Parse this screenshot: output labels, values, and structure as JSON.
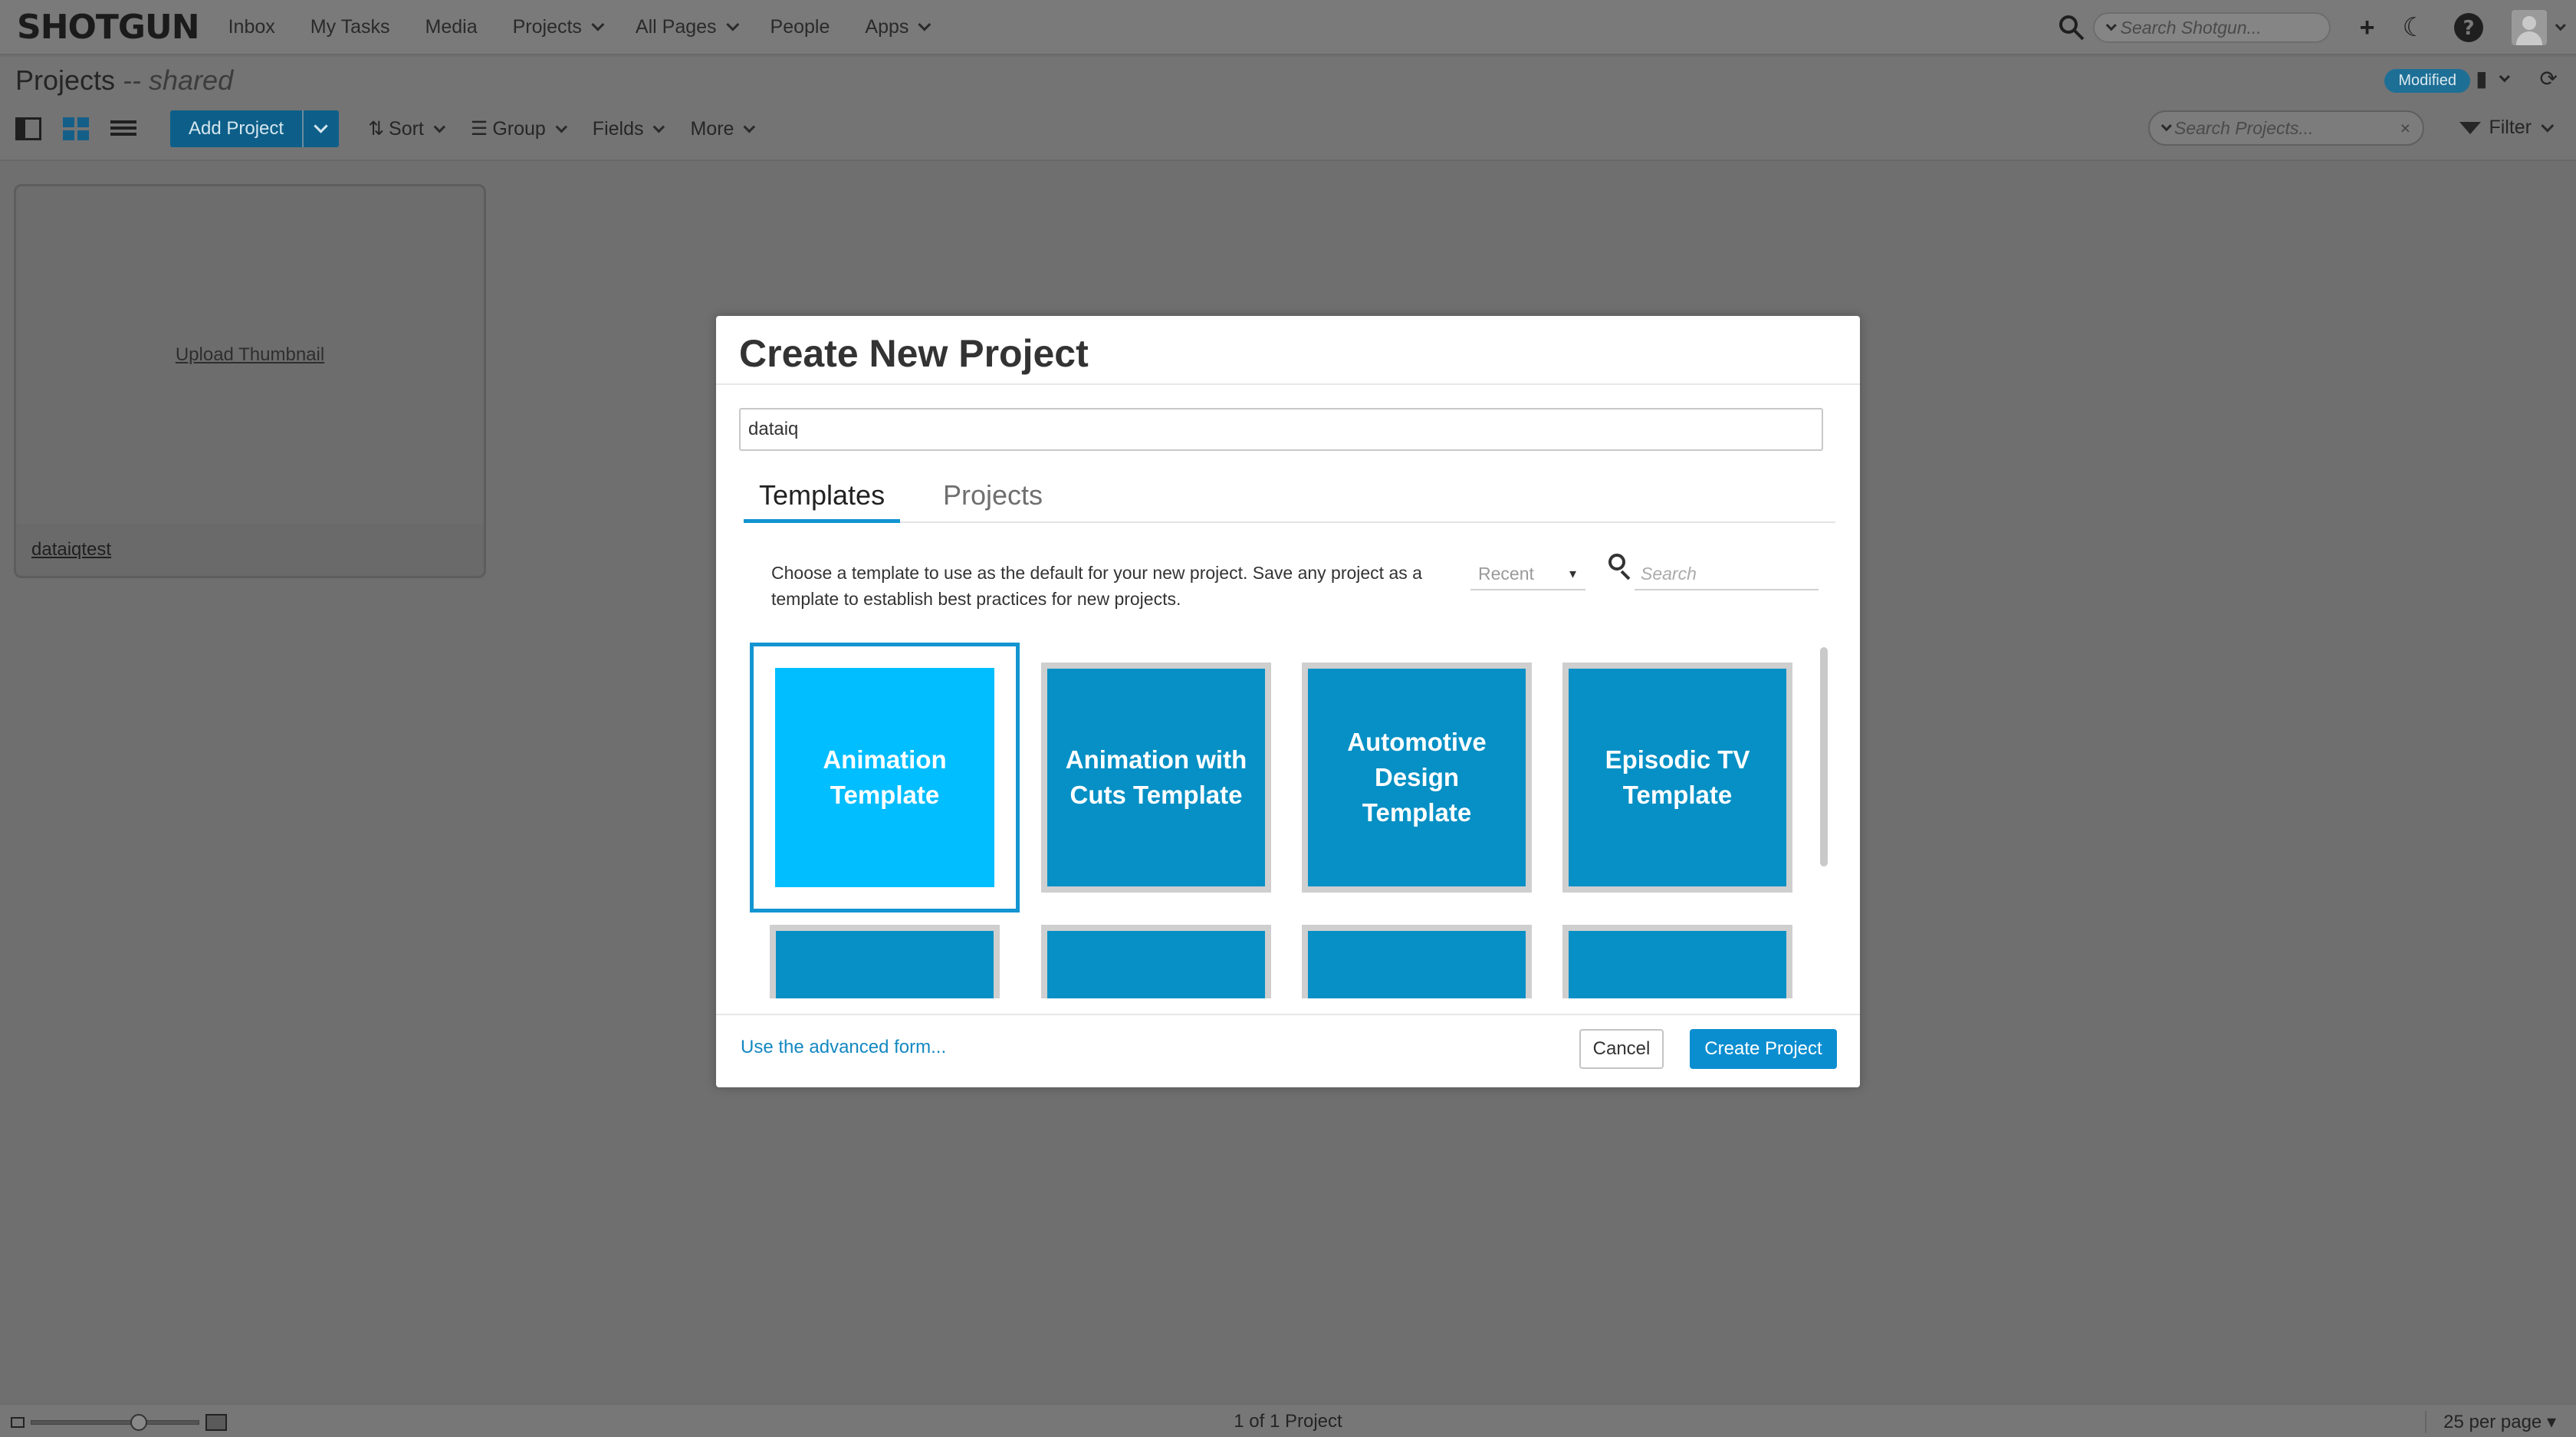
{
  "app": {
    "brand": "SHOTGUN"
  },
  "nav": {
    "items": [
      {
        "label": "Inbox",
        "dropdown": false
      },
      {
        "label": "My Tasks",
        "dropdown": false
      },
      {
        "label": "Media",
        "dropdown": false
      },
      {
        "label": "Projects",
        "dropdown": true
      },
      {
        "label": "All Pages",
        "dropdown": true
      },
      {
        "label": "People",
        "dropdown": false
      },
      {
        "label": "Apps",
        "dropdown": true
      }
    ],
    "search_placeholder": "Search Shotgun..."
  },
  "page": {
    "title": "Projects",
    "subtitle": "-- shared",
    "status_badge": "Modified"
  },
  "toolbar": {
    "add_project_label": "Add Project",
    "sort_label": "Sort",
    "group_label": "Group",
    "fields_label": "Fields",
    "more_label": "More",
    "search_placeholder": "Search Projects...",
    "filter_label": "Filter"
  },
  "project_card": {
    "upload_label": "Upload Thumbnail",
    "name": "dataiqtest"
  },
  "modal": {
    "title": "Create New Project",
    "project_name_value": "dataiq",
    "tabs": [
      {
        "label": "Templates",
        "active": true
      },
      {
        "label": "Projects",
        "active": false
      }
    ],
    "description": "Choose a template to use as the default for your new project. Save any project as a template to establish best practices for new projects.",
    "sort_value": "Recent",
    "sort_arrow": "▾",
    "search_placeholder": "Search",
    "templates": [
      {
        "label": "Animation Template",
        "selected": true
      },
      {
        "label": "Animation with Cuts Template",
        "selected": false
      },
      {
        "label": "Automotive Design Template",
        "selected": false
      },
      {
        "label": "Episodic TV Template",
        "selected": false
      },
      {
        "label": "",
        "selected": false
      },
      {
        "label": "",
        "selected": false
      },
      {
        "label": "",
        "selected": false
      },
      {
        "label": "",
        "selected": false
      }
    ],
    "advanced_link": "Use the advanced form...",
    "cancel_label": "Cancel",
    "create_label": "Create Project"
  },
  "footer": {
    "page_count": "1 of 1 Project",
    "per_page": "25 per page ▾",
    "zoom_level": 0.66
  },
  "colors": {
    "accent": "#1295d1",
    "tile": "#0690c5",
    "tile_selected": "#00beff",
    "overlay": "#6f6f6f"
  }
}
